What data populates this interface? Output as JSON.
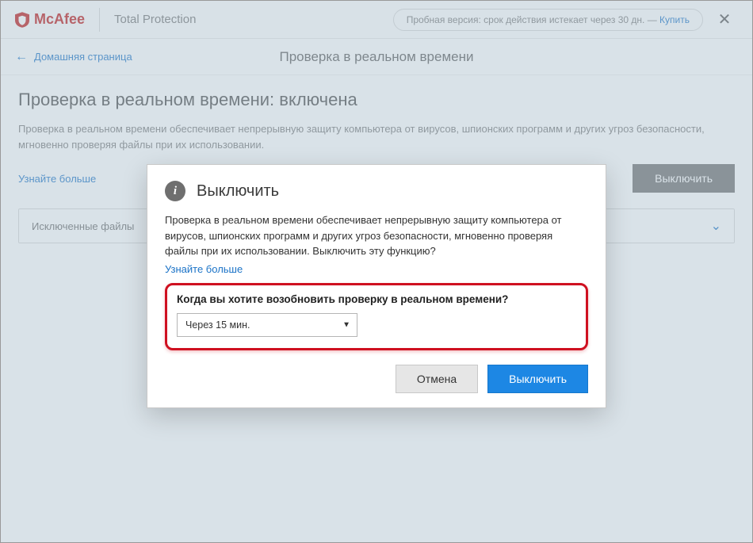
{
  "brand": {
    "name": "McAfee",
    "product": "Total Protection"
  },
  "trial": {
    "prefix": "Пробная версия: срок действия истекает через 30 дн. — ",
    "buy": "Купить"
  },
  "nav": {
    "back": "Домашняя страница",
    "section_title": "Проверка в реальном времени"
  },
  "page": {
    "title": "Проверка в реальном времени: включена",
    "description": "Проверка в реальном времени обеспечивает непрерывную защиту компьютера от вирусов, шпионских программ и других угроз безопасности, мгновенно проверяя файлы при их использовании.",
    "learn_more": "Узнайте больше",
    "disable_button": "Выключить",
    "accordion_excluded": "Исключенные файлы"
  },
  "modal": {
    "title": "Выключить",
    "body": "Проверка в реальном времени обеспечивает непрерывную защиту компьютера от вирусов, шпионских программ и других угроз безопасности, мгновенно проверяя файлы при их использовании. Выключить эту функцию?",
    "learn_more": "Узнайте больше",
    "question": "Когда вы хотите возобновить проверку в реальном времени?",
    "selected_option": "Через 15 мин.",
    "cancel": "Отмена",
    "confirm": "Выключить"
  },
  "colors": {
    "brand_red": "#c01818",
    "link_blue": "#1b73c7",
    "primary_blue": "#1d87e4",
    "highlight_red": "#cf1020"
  }
}
